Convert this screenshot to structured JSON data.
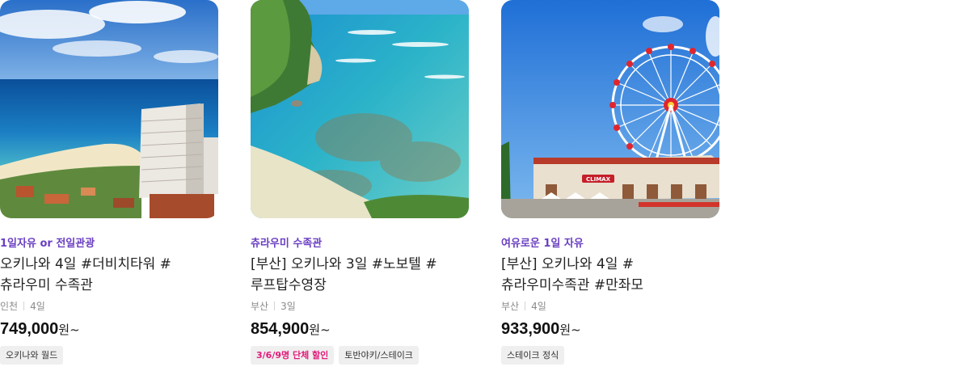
{
  "cards": [
    {
      "image": "okinawa-resort-hotel-beach",
      "tagline": "1일자유 or 전일관광",
      "title": "오키나와 4일 #더비치타워 #츄라우미 수족관",
      "origin": "인천",
      "duration": "4일",
      "price": "749,000",
      "currency": "원~",
      "badges": [
        "오키나와 월드"
      ]
    },
    {
      "image": "okinawa-coral-coast",
      "tagline": "츄라우미 수족관",
      "title": "[부산] 오키나와 3일 #노보텔 #루프탑수영장",
      "origin": "부산",
      "duration": "3일",
      "price": "854,900",
      "currency": "원~",
      "promo_badge": "3/6/9명 단체 할인",
      "badges": [
        "토반야키/스테이크"
      ]
    },
    {
      "image": "american-village-ferris-wheel",
      "tagline": "여유로운 1일 자유",
      "title": "[부산] 오키나와 4일 #츄라우미수족관 #만좌모",
      "origin": "부산",
      "duration": "4일",
      "price": "933,900",
      "currency": "원~",
      "badges": [
        "스테이크 정식"
      ]
    }
  ],
  "sign_text": "CLIMAX"
}
